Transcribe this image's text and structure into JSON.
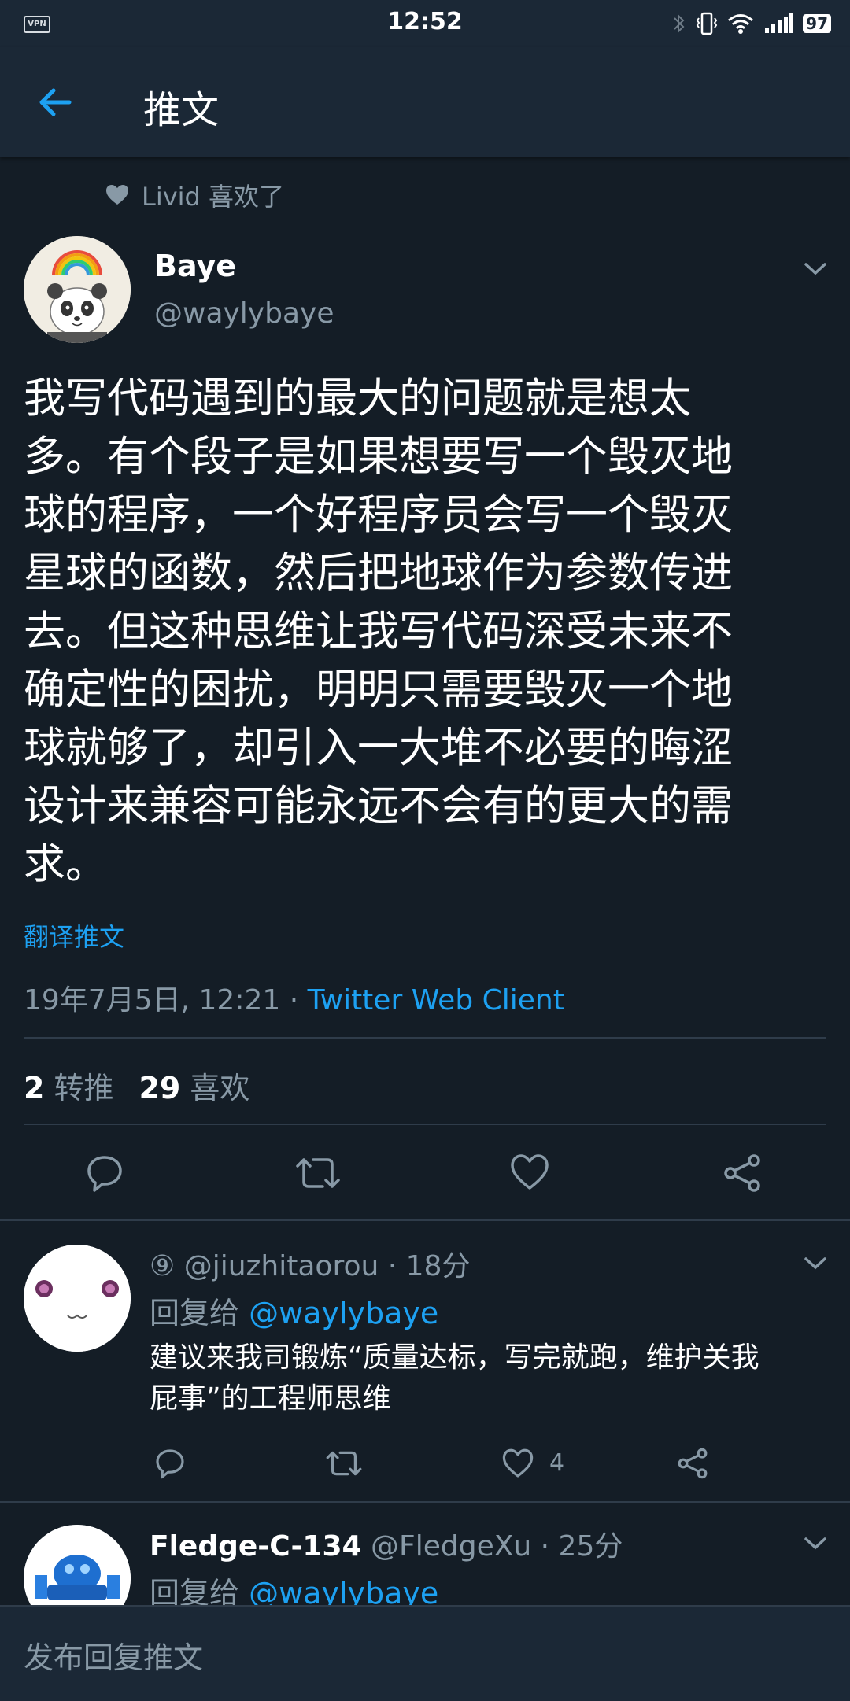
{
  "status_bar": {
    "vpn": "VPN",
    "time": "12:52",
    "battery": "97",
    "icons": [
      "bluetooth-icon",
      "vibrate-icon",
      "wifi-icon",
      "signal-icon",
      "battery-icon"
    ]
  },
  "header": {
    "back_icon": "back-arrow-icon",
    "title": "推文"
  },
  "social_context": {
    "icon": "heart-icon",
    "text": "Livid 喜欢了"
  },
  "tweet": {
    "author_name": "Baye",
    "author_handle": "@waylybaye",
    "lines": [
      "我写代码遇到的最大的问题就是想太",
      "多。有个段子是如果想要写一个毁灭地",
      "球的程序，一个好程序员会写一个毁灭",
      "星球的函数，然后把地球作为参数传进",
      "去。但这种思维让我写代码深受未来不",
      "确定性的困扰，明明只需要毁灭一个地",
      "球就够了，却引入一大堆不必要的晦涩",
      "设计来兼容可能永远不会有的更大的需",
      "求。"
    ],
    "translate_label": "翻译推文",
    "timestamp": "19年7月5日, 12:21 · ",
    "client": "Twitter Web Client",
    "retweet_count": "2",
    "retweet_label": "转推",
    "like_count": "29",
    "like_label": "喜欢",
    "actions": [
      "reply-icon",
      "retweet-icon",
      "like-icon",
      "share-icon"
    ]
  },
  "replies": [
    {
      "name": "",
      "handle_prefix": "⑨ ",
      "handle": "@jiuzhitaorou",
      "time": " · 18分",
      "reply_to_label": "回复给 ",
      "reply_to": "@waylybaye",
      "text_lines": [
        "建议来我司锻炼“质量达标，写完就跑，维护关我",
        "屁事”的工程师思维"
      ],
      "like_count": "4"
    },
    {
      "name": "Fledge-C-134",
      "handle": "@FledgeXu",
      "time": " · 25分",
      "reply_to_label": "回复给 ",
      "reply_to": "@waylybaye"
    }
  ],
  "compose": {
    "placeholder": "发布回复推文"
  },
  "colors": {
    "background": "#141d26",
    "bar": "#1b2836",
    "accent": "#1da1f2",
    "muted": "#8899a6"
  }
}
